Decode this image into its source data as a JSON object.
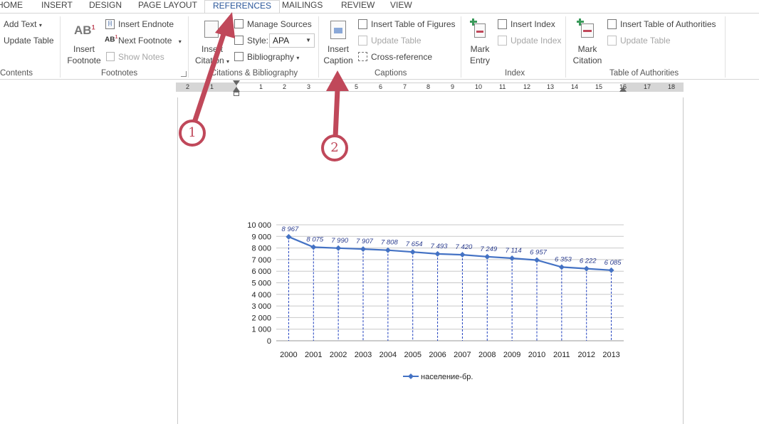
{
  "tabs": [
    "HOME",
    "INSERT",
    "DESIGN",
    "PAGE LAYOUT",
    "REFERENCES",
    "MAILINGS",
    "REVIEW",
    "VIEW"
  ],
  "ribbon": {
    "toc": {
      "add_text": "Add Text",
      "update_table": "Update Table",
      "group": "Contents"
    },
    "footnotes": {
      "insert_footnote_line1": "Insert",
      "insert_footnote_line2": "Footnote",
      "insert_endnote": "Insert Endnote",
      "next_footnote": "Next Footnote",
      "show_notes": "Show Notes",
      "group": "Footnotes"
    },
    "citations": {
      "insert_citation_line1": "Insert",
      "insert_citation_line2": "Citation",
      "manage_sources": "Manage Sources",
      "style_label": "Style:",
      "style_value": "APA",
      "bibliography": "Bibliography",
      "group": "Citations & Bibliography"
    },
    "captions": {
      "insert_caption_line1": "Insert",
      "insert_caption_line2": "Caption",
      "insert_table_of_figures": "Insert Table of Figures",
      "update_table": "Update Table",
      "cross_reference": "Cross-reference",
      "group": "Captions"
    },
    "index": {
      "mark_entry_line1": "Mark",
      "mark_entry_line2": "Entry",
      "insert_index": "Insert Index",
      "update_index": "Update Index",
      "group": "Index"
    },
    "authorities": {
      "mark_citation_line1": "Mark",
      "mark_citation_line2": "Citation",
      "insert_table_of_authorities": "Insert Table of Authorities",
      "update_table": "Update Table",
      "group": "Table of Authorities"
    }
  },
  "ruler": [
    "2",
    "1",
    "1",
    "2",
    "3",
    "4",
    "5",
    "6",
    "7",
    "8",
    "9",
    "10",
    "11",
    "12",
    "13",
    "14",
    "15",
    "16",
    "17",
    "18"
  ],
  "callouts": [
    "1",
    "2"
  ],
  "colors": {
    "accent": "#2b579a",
    "series": "#4472c4",
    "callout": "#c0485a"
  },
  "chart_data": {
    "type": "line",
    "categories": [
      "2000",
      "2001",
      "2002",
      "2003",
      "2004",
      "2005",
      "2006",
      "2007",
      "2008",
      "2009",
      "2010",
      "2011",
      "2012",
      "2013"
    ],
    "series": [
      {
        "name": "население-бр.",
        "values": [
          8967,
          8075,
          7990,
          7907,
          7808,
          7654,
          7493,
          7420,
          7249,
          7114,
          6957,
          6353,
          6222,
          6085
        ]
      }
    ],
    "data_labels": [
      "8 967",
      "8 075",
      "7 990",
      "7 907",
      "7 808",
      "7 654",
      "7 493",
      "7 420",
      "7 249",
      "7 114",
      "6 957",
      "6 353",
      "6 222",
      "6 085"
    ],
    "yticks": [
      "0",
      "1 000",
      "2 000",
      "3 000",
      "4 000",
      "5 000",
      "6 000",
      "7 000",
      "8 000",
      "9 000",
      "10 000"
    ],
    "ylim": [
      0,
      10000
    ],
    "grid": true,
    "drop_lines": true,
    "legend": "bottom"
  }
}
